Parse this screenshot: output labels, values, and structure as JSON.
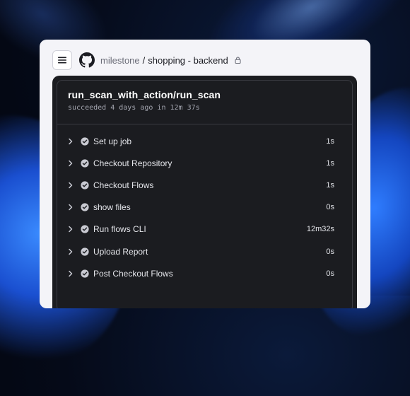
{
  "repo": {
    "owner": "milestone",
    "separator": "/",
    "name": "shopping - backend"
  },
  "run": {
    "title": "run_scan_with_action/run_scan",
    "subtitle": "succeeded 4 days ago in 12m 37s"
  },
  "steps": [
    {
      "label": "Set up job",
      "duration": "1s"
    },
    {
      "label": "Checkout Repository",
      "duration": "1s"
    },
    {
      "label": "Checkout Flows",
      "duration": "1s"
    },
    {
      "label": "show files",
      "duration": "0s"
    },
    {
      "label": "Run flows CLI",
      "duration": "12m32s"
    },
    {
      "label": "Upload Report",
      "duration": "0s"
    },
    {
      "label": "Post Checkout Flows",
      "duration": "0s"
    }
  ],
  "icons": {
    "menu": "hamburger-icon",
    "repo": "github-icon",
    "visibility": "lock-icon",
    "expand": "chevron-right-icon",
    "status": "check-circle-icon"
  },
  "colors": {
    "card_bg": "#f4f4f8",
    "panel_bg": "#1b1c20",
    "success_icon": "#c9cad2"
  }
}
